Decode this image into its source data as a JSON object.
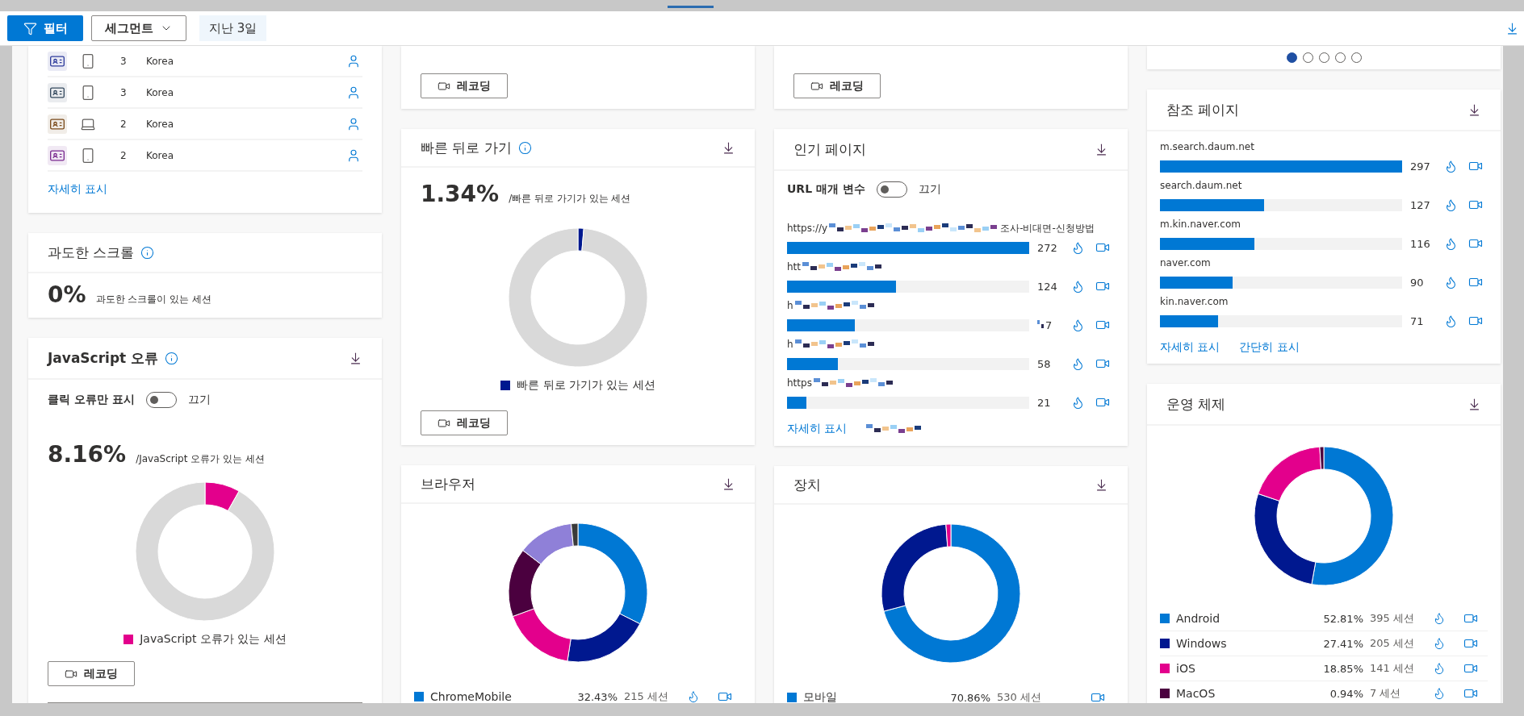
{
  "top_bar": {
    "filter_button": "필터",
    "segment_dropdown": "세그먼트",
    "date_range": "지난 3일"
  },
  "columns": [
    {
      "cards": [
        {
          "kind": "users",
          "rows": [
            {
              "color": "#2f3d9c",
              "kind": "phone",
              "count": "3",
              "country": "Korea"
            },
            {
              "color": "#34495e",
              "kind": "phone",
              "count": "3",
              "country": "Korea"
            },
            {
              "color": "#7a4a1a",
              "kind": "laptop",
              "count": "2",
              "country": "Korea"
            },
            {
              "color": "#7a2a8f",
              "kind": "phone",
              "count": "2",
              "country": "Korea"
            }
          ],
          "link": "자세히 표시"
        },
        {
          "kind": "stat",
          "title": "과도한 스크롤",
          "info": true,
          "stat": "0%",
          "caption": "과도한 스크롤이 있는 세션"
        },
        {
          "kind": "donut",
          "title": "JavaScript 오류",
          "info": true,
          "download": true,
          "toggle": {
            "label": "클릭 오류만 표시",
            "on": false,
            "state": "끄기"
          },
          "stat": "8.16%",
          "caption": "/JavaScript 오류가 있는 세션",
          "chart_data": {
            "type": "donut",
            "values": [
              8.16,
              91.84
            ]
          },
          "legend": [
            {
              "name": "JavaScript 오류가 있는 세션",
              "color": "#e3008c"
            }
          ],
          "button": "레코딩"
        }
      ]
    },
    {
      "cards": [
        {
          "kind": "footer",
          "button": "레코딩"
        },
        {
          "kind": "donut",
          "title": "빠른 뒤로 가기",
          "info": true,
          "download": true,
          "stat": "1.34%",
          "caption": "/빠른 뒤로 가기가 있는 세션",
          "chart_data": {
            "type": "donut",
            "values": [
              1.34,
              98.66
            ]
          },
          "legend": [
            {
              "name": "빠른 뒤로 가기가 있는 세션",
              "color": "#00188f"
            }
          ],
          "button": "레코딩"
        },
        {
          "kind": "breakdown",
          "title": "브라우저",
          "download": true,
          "picture": {
            "kind": "browsers"
          },
          "rows": [
            {
              "name": "ChromeMobile",
              "color": "#0078d4",
              "share": "32.43%",
              "sessions": "215 세션",
              "heatmap": true
            }
          ]
        }
      ]
    },
    {
      "cards": [
        {
          "kind": "footer",
          "button": "레코딩"
        },
        {
          "kind": "bars",
          "title": "인기 페이지",
          "download": true,
          "toggle": {
            "label": "URL 매개 변수",
            "on": false,
            "state": "끄기"
          },
          "rows": [
            {
              "parts": [
                {
                  "kind": "text",
                  "text": "https://y"
                },
                {
                  "kind": "redacted"
                },
                {
                  "kind": "text",
                  "text": "조사-비대면-신청방법"
                }
              ],
              "level": 1,
              "count": "272"
            },
            {
              "parts": [
                {
                  "kind": "text",
                  "text": "htt"
                },
                {
                  "kind": "redacted"
                }
              ],
              "level": 0.45,
              "count": "124"
            },
            {
              "parts": [
                {
                  "kind": "text",
                  "text": "h"
                },
                {
                  "kind": "redacted"
                }
              ],
              "level": 0.28,
              "count": "7",
              "count_redacted": true
            },
            {
              "parts": [
                {
                  "kind": "text",
                  "text": "h"
                },
                {
                  "kind": "redacted"
                }
              ],
              "level": 0.21,
              "count": "58"
            },
            {
              "parts": [
                {
                  "kind": "text",
                  "text": "https"
                },
                {
                  "kind": "redacted"
                }
              ],
              "level": 0.08,
              "count": "21"
            }
          ],
          "links": [
            {
              "kind": "link",
              "text": "자세히 표시"
            },
            {
              "kind": "redacted"
            }
          ]
        },
        {
          "kind": "breakdown",
          "title": "장치",
          "download": true,
          "picture": {
            "kind": "devices"
          },
          "rows": [
            {
              "name": "모바일",
              "color": "#0078d4",
              "share": "70.86%",
              "sessions": "530 세션",
              "heatmap": false
            }
          ]
        }
      ]
    },
    {
      "cards": [
        {
          "kind": "dots",
          "dots": [
            {
              "selected": true
            },
            {
              "selected": false
            },
            {
              "selected": false
            },
            {
              "selected": false
            },
            {
              "selected": false
            }
          ]
        },
        {
          "kind": "bars",
          "title": "참조 페이지",
          "download": true,
          "rows": [
            {
              "label": "m.search.daum.net",
              "level": 1,
              "count": "297"
            },
            {
              "label": "search.daum.net",
              "level": 0.43,
              "count": "127"
            },
            {
              "label": "m.kin.naver.com",
              "level": 0.39,
              "count": "116"
            },
            {
              "label": "naver.com",
              "level": 0.3,
              "count": "90"
            },
            {
              "label": "kin.naver.com",
              "level": 0.24,
              "count": "71"
            }
          ],
          "links": [
            {
              "kind": "link",
              "text": "자세히 표시"
            },
            {
              "kind": "link",
              "text": "간단히 표시"
            }
          ]
        },
        {
          "kind": "breakdown",
          "title": "운영 체제",
          "download": true,
          "chart_data": {
            "type": "donut",
            "values": [
              52.81,
              27.41,
              18.85,
              0.94
            ]
          },
          "rows": [
            {
              "name": "Android",
              "color": "#0078d4",
              "share": "52.81%",
              "sessions": "395 세션",
              "heatmap": true
            },
            {
              "name": "Windows",
              "color": "#00188f",
              "share": "27.41%",
              "sessions": "205 세션",
              "heatmap": true
            },
            {
              "name": "iOS",
              "color": "#e3008c",
              "share": "18.85%",
              "sessions": "141 세션",
              "heatmap": true
            },
            {
              "name": "MacOS",
              "color": "#4b003f",
              "share": "0.94%",
              "sessions": "7 세션",
              "heatmap": true
            }
          ]
        }
      ]
    }
  ]
}
